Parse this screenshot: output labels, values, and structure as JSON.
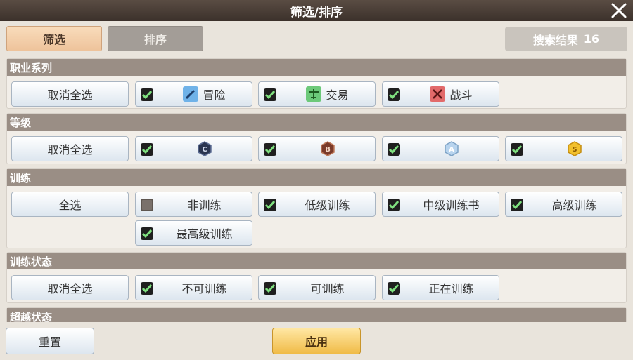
{
  "title": "筛选/排序",
  "tabs": {
    "filter": "筛选",
    "sort": "排序"
  },
  "result": {
    "label": "搜索结果",
    "count": "16"
  },
  "sections": {
    "profession": {
      "header": "职业系列",
      "select_all": "取消全选",
      "options": [
        {
          "label": "冒险",
          "checked": true,
          "icon": "pen-icon",
          "color": "#6fb2e8"
        },
        {
          "label": "交易",
          "checked": true,
          "icon": "scale-icon",
          "color": "#6cc97a"
        },
        {
          "label": "战斗",
          "checked": true,
          "icon": "swords-icon",
          "color": "#e26a6a"
        }
      ]
    },
    "grade": {
      "header": "等级",
      "select_all": "取消全选",
      "options": [
        {
          "label": "C",
          "checked": true,
          "icon": "grade-c-icon",
          "color": "#2a3550"
        },
        {
          "label": "B",
          "checked": true,
          "icon": "grade-b-icon",
          "color": "#7a3a2a"
        },
        {
          "label": "A",
          "checked": true,
          "icon": "grade-a-icon",
          "color": "#b8d4ee"
        },
        {
          "label": "S",
          "checked": true,
          "icon": "grade-s-icon",
          "color": "#f2c02c"
        }
      ]
    },
    "training": {
      "header": "训练",
      "select_all": "全选",
      "options": [
        {
          "label": "非训练",
          "checked": false
        },
        {
          "label": "低级训练",
          "checked": true
        },
        {
          "label": "中级训练书",
          "checked": true
        },
        {
          "label": "高级训练",
          "checked": true
        },
        {
          "label": "最高级训练",
          "checked": true
        }
      ]
    },
    "training_status": {
      "header": "训练状态",
      "select_all": "取消全选",
      "options": [
        {
          "label": "不可训练",
          "checked": true
        },
        {
          "label": "可训练",
          "checked": true
        },
        {
          "label": "正在训练",
          "checked": true
        }
      ]
    },
    "transcend": {
      "header": "超越状态"
    }
  },
  "footer": {
    "reset": "重置",
    "apply": "应用"
  }
}
